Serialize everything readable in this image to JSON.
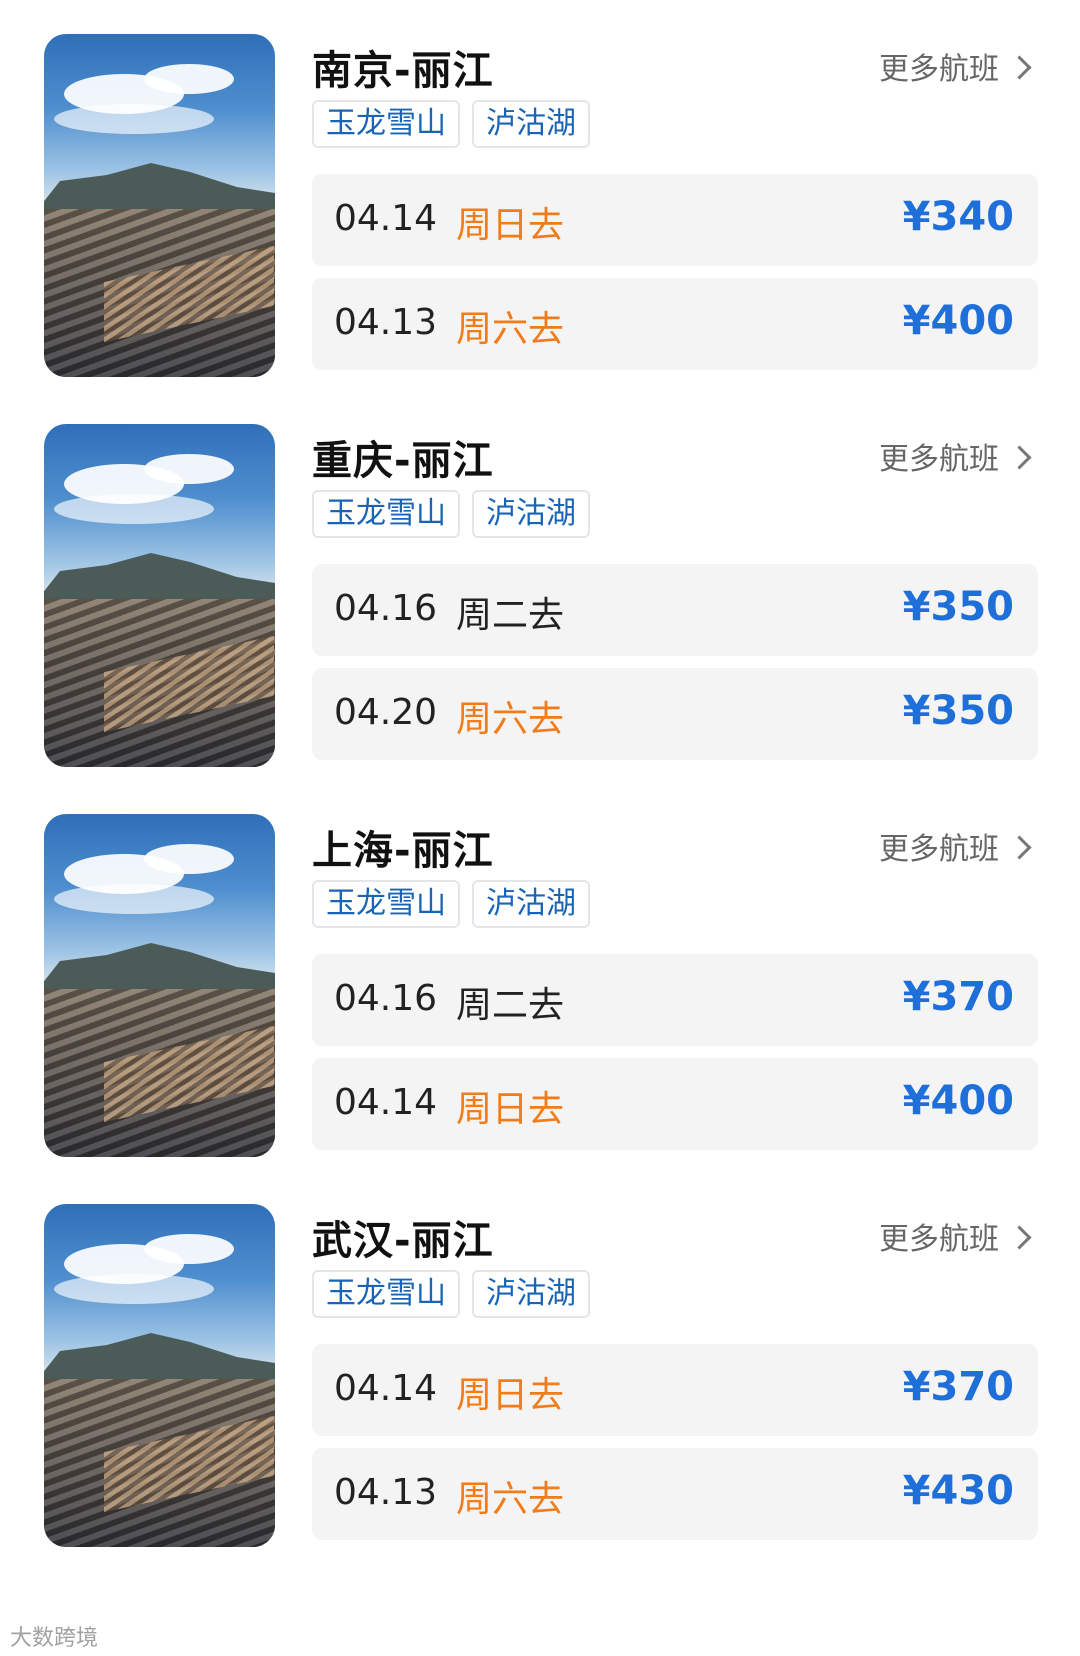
{
  "routes": [
    {
      "title": "南京-丽江",
      "more": "更多航班",
      "tags": [
        "玉龙雪山",
        "泸沽湖"
      ],
      "flights": [
        {
          "date": "04.14",
          "day": "周日去",
          "weekend": true,
          "price": "¥340"
        },
        {
          "date": "04.13",
          "day": "周六去",
          "weekend": true,
          "price": "¥400"
        }
      ]
    },
    {
      "title": "重庆-丽江",
      "more": "更多航班",
      "tags": [
        "玉龙雪山",
        "泸沽湖"
      ],
      "flights": [
        {
          "date": "04.16",
          "day": "周二去",
          "weekend": false,
          "price": "¥350"
        },
        {
          "date": "04.20",
          "day": "周六去",
          "weekend": true,
          "price": "¥350"
        }
      ]
    },
    {
      "title": "上海-丽江",
      "more": "更多航班",
      "tags": [
        "玉龙雪山",
        "泸沽湖"
      ],
      "flights": [
        {
          "date": "04.16",
          "day": "周二去",
          "weekend": false,
          "price": "¥370"
        },
        {
          "date": "04.14",
          "day": "周日去",
          "weekend": true,
          "price": "¥400"
        }
      ]
    },
    {
      "title": "武汉-丽江",
      "more": "更多航班",
      "tags": [
        "玉龙雪山",
        "泸沽湖"
      ],
      "flights": [
        {
          "date": "04.14",
          "day": "周日去",
          "weekend": true,
          "price": "¥370"
        },
        {
          "date": "04.13",
          "day": "周六去",
          "weekend": true,
          "price": "¥430"
        }
      ]
    }
  ],
  "watermark": "大数跨境",
  "colors": {
    "price": "#1e6fd9",
    "weekend": "#f07c1a",
    "tag_text": "#1a64b6"
  }
}
